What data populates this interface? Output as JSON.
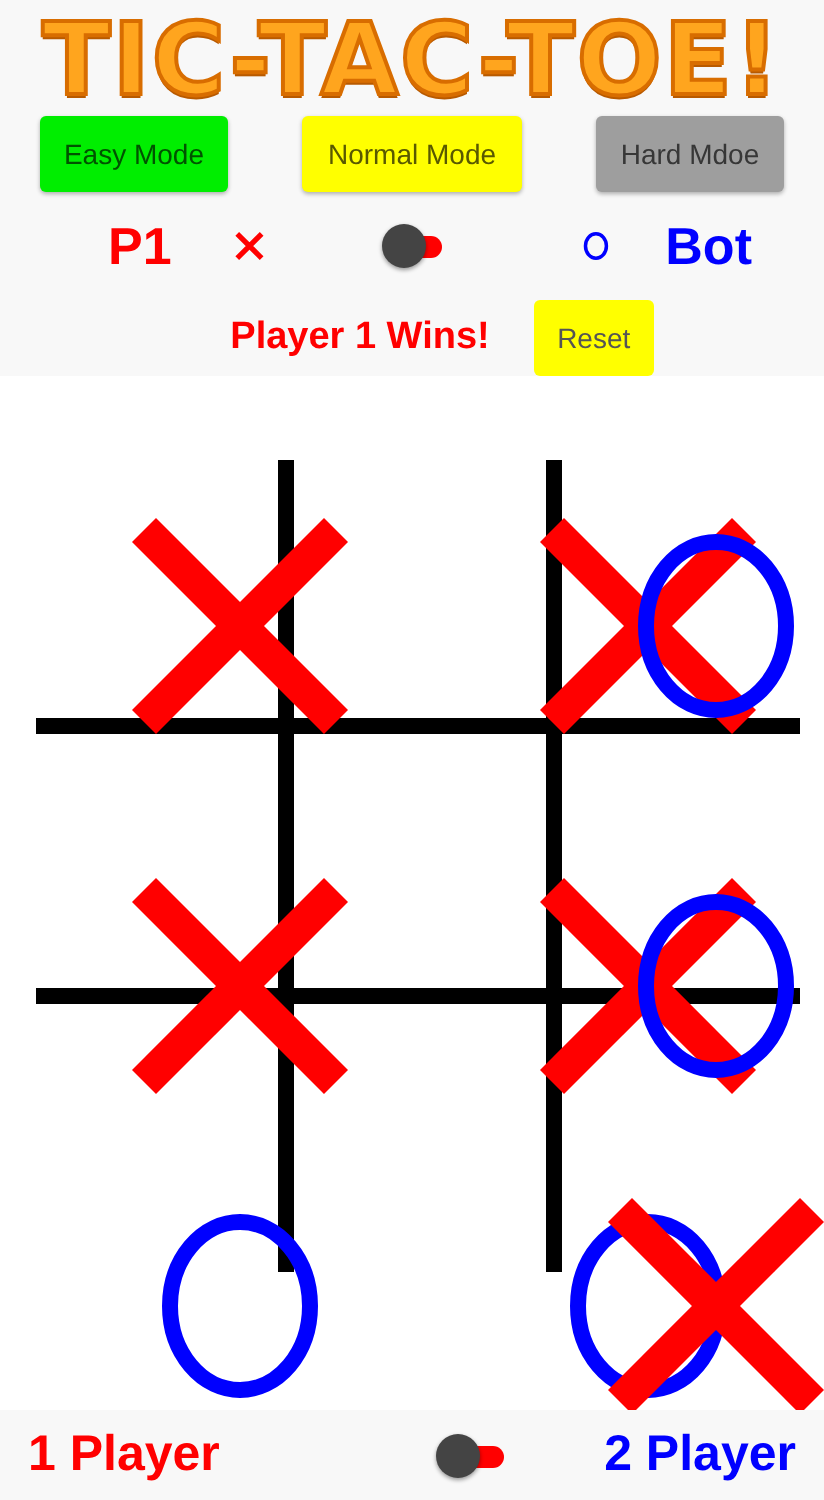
{
  "title": "TIC-TAC-TOE!",
  "modes": [
    {
      "label": "Easy Mode",
      "color": "#00ee00"
    },
    {
      "label": "Normal Mode",
      "color": "#ffff00"
    },
    {
      "label": "Hard Mdoe",
      "color": "#9e9e9e"
    }
  ],
  "players": {
    "left": "P1",
    "right": "Bot",
    "switch": {
      "on": false
    }
  },
  "status": "Player 1 Wins!",
  "reset": "Reset",
  "board": [
    [
      {
        "kind": "marked",
        "marks": [
          {
            "kind": "x"
          }
        ]
      },
      {
        "kind": "empty"
      },
      {
        "kind": "marked",
        "marks": [
          {
            "kind": "x"
          },
          {
            "kind": "o"
          }
        ]
      }
    ],
    [
      {
        "kind": "marked",
        "marks": [
          {
            "kind": "x"
          }
        ]
      },
      {
        "kind": "empty"
      },
      {
        "kind": "marked",
        "marks": [
          {
            "kind": "x"
          },
          {
            "kind": "o"
          }
        ]
      }
    ],
    [
      {
        "kind": "marked",
        "marks": [
          {
            "kind": "o"
          }
        ]
      },
      {
        "kind": "empty"
      },
      {
        "kind": "marked",
        "marks": [
          {
            "kind": "o"
          },
          {
            "kind": "x"
          }
        ]
      }
    ]
  ],
  "footer": {
    "left": "1 Player",
    "right": "2 Player",
    "switch": {
      "on": false
    }
  }
}
